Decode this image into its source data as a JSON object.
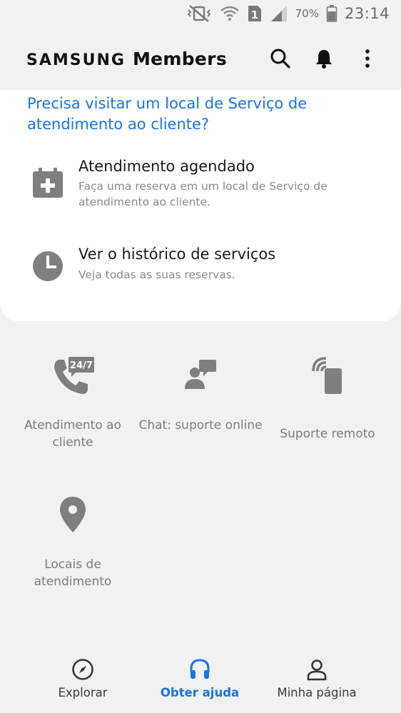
{
  "status_bar": {
    "battery": "70%",
    "time": "23:14",
    "sim": "1",
    "icons": [
      "vibrate-mute-icon",
      "wifi-icon",
      "sim-icon",
      "signal-icon",
      "battery-icon"
    ]
  },
  "header": {
    "brand": "SAMSUNG",
    "app_name": "Members",
    "actions": [
      "search-icon",
      "bell-icon",
      "more-vert-icon"
    ]
  },
  "card": {
    "title": "Precisa visitar um local de Serviço de atendimento ao cliente?",
    "items": [
      {
        "title": "Atendimento agendado",
        "description": "Faça uma reserva em um local de Serviço de atendimento ao cliente.",
        "icon": "calendar-add-icon"
      },
      {
        "title": "Ver o histórico de serviços",
        "description": "Veja todas as suas reservas.",
        "icon": "clock-icon"
      }
    ]
  },
  "support": {
    "tiles": [
      {
        "label": "Atendimento ao cliente",
        "icon": "phone-24-7-icon",
        "badge": "24/7"
      },
      {
        "label": "Chat: suporte online",
        "icon": "chat-support-icon"
      },
      {
        "label": "Suporte remoto",
        "icon": "remote-support-icon"
      },
      {
        "label": "Locais de atendimento",
        "icon": "location-pin-icon"
      }
    ]
  },
  "bottom_nav": {
    "items": [
      {
        "label": "Explorar",
        "icon": "compass-icon"
      },
      {
        "label": "Obter ajuda",
        "icon": "headset-icon",
        "active": true
      },
      {
        "label": "Minha página",
        "icon": "person-icon"
      }
    ]
  },
  "colors": {
    "accent": "#1a73e8",
    "background": "#f1f1f1",
    "card": "#ffffff",
    "icon_gray": "#808080"
  }
}
